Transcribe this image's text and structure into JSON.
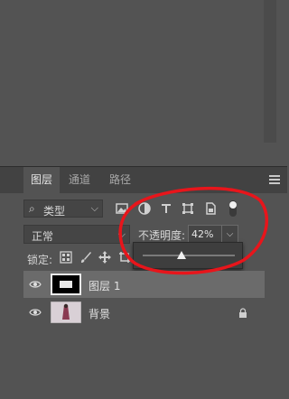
{
  "tabs": [
    {
      "label": "图层",
      "active": true
    },
    {
      "label": "通道",
      "active": false
    },
    {
      "label": "路径",
      "active": false
    }
  ],
  "filter": {
    "kind_label": "类型",
    "kind_icon": "search-icon"
  },
  "filter_icons": [
    "image-filter-icon",
    "adjustment-filter-icon",
    "type-filter-icon",
    "shape-filter-icon",
    "smart-object-filter-icon",
    "filter-toggle-icon"
  ],
  "blend": {
    "mode": "正常"
  },
  "opacity": {
    "label": "不透明度:",
    "value": "42%",
    "percent": 42
  },
  "lock": {
    "label": "锁定:",
    "icons": [
      "lock-transparent-icon",
      "lock-paint-icon",
      "lock-position-icon",
      "lock-artboard-icon"
    ]
  },
  "layers": [
    {
      "name": "图层 1",
      "selected": true,
      "visible": true,
      "locked": false
    },
    {
      "name": "背景",
      "selected": false,
      "visible": true,
      "locked": true
    }
  ],
  "colors": {
    "panel": "#535353",
    "tabbar": "#424242",
    "selected_row": "#6b6b6b",
    "annotation": "#e8151b"
  }
}
